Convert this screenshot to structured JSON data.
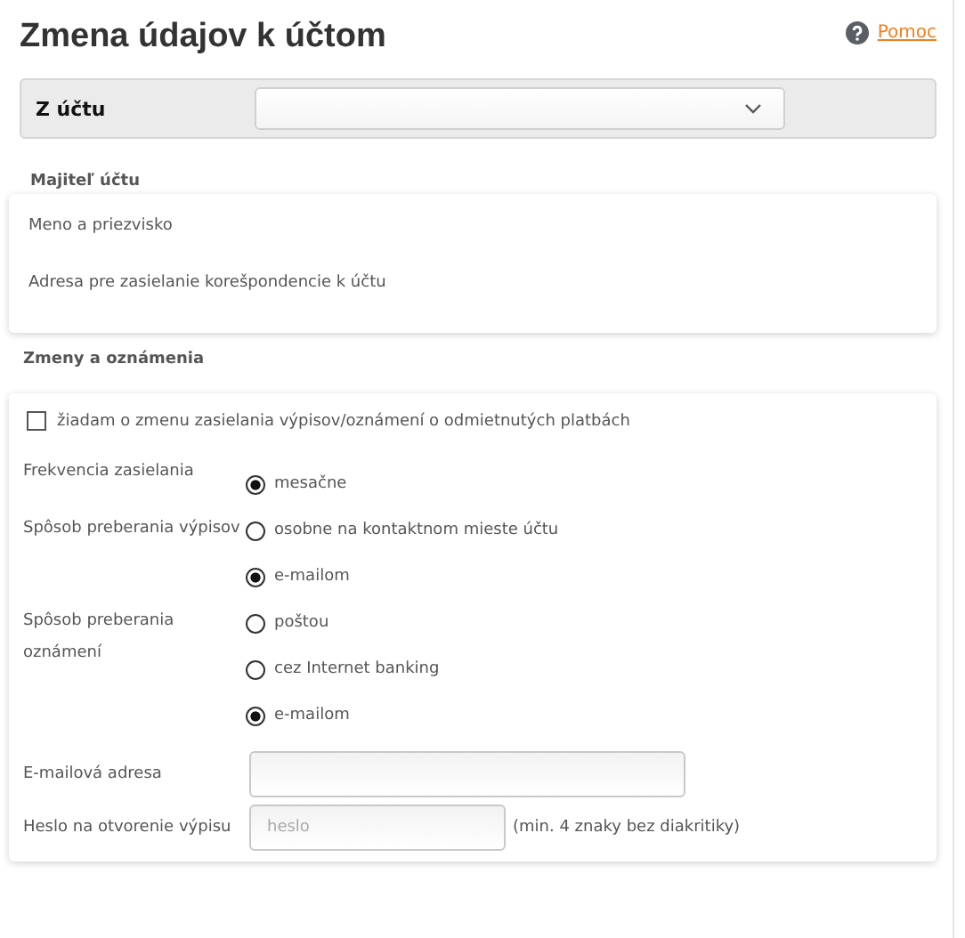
{
  "title": "Zmena údajov k účtom",
  "help_link": "Pomoc",
  "account": {
    "label": "Z účtu"
  },
  "owner": {
    "heading": "Majiteľ účtu",
    "fields": [
      "Meno a priezvisko",
      "Adresa pre zasielanie korešpondencie k účtu"
    ]
  },
  "changes": {
    "heading": "Zmeny a oznámenia",
    "request": {
      "label": "žiadam o zmenu zasielania výpisov/oznámení o odmietnutých platbách",
      "checked": false
    },
    "radio_groups": [
      {
        "label": "Frekvencia zasielania",
        "options": [
          {
            "label": "mesačne",
            "selected": true
          }
        ]
      },
      {
        "label": "Spôsob preberania výpisov",
        "options": [
          {
            "label": "osobne na kontaktnom mieste účtu",
            "selected": false
          },
          {
            "label": "e-mailom",
            "selected": true
          }
        ]
      },
      {
        "label": "Spôsob preberania oznámení",
        "options": [
          {
            "label": "poštou",
            "selected": false
          },
          {
            "label": "cez Internet banking",
            "selected": false
          },
          {
            "label": "e-mailom",
            "selected": true
          }
        ]
      }
    ],
    "email": {
      "label": "E-mailová adresa"
    },
    "password": {
      "label": "Heslo na otvorenie výpisu",
      "placeholder": "heslo",
      "hint": "(min. 4 znaky bez diakritiky)"
    }
  }
}
